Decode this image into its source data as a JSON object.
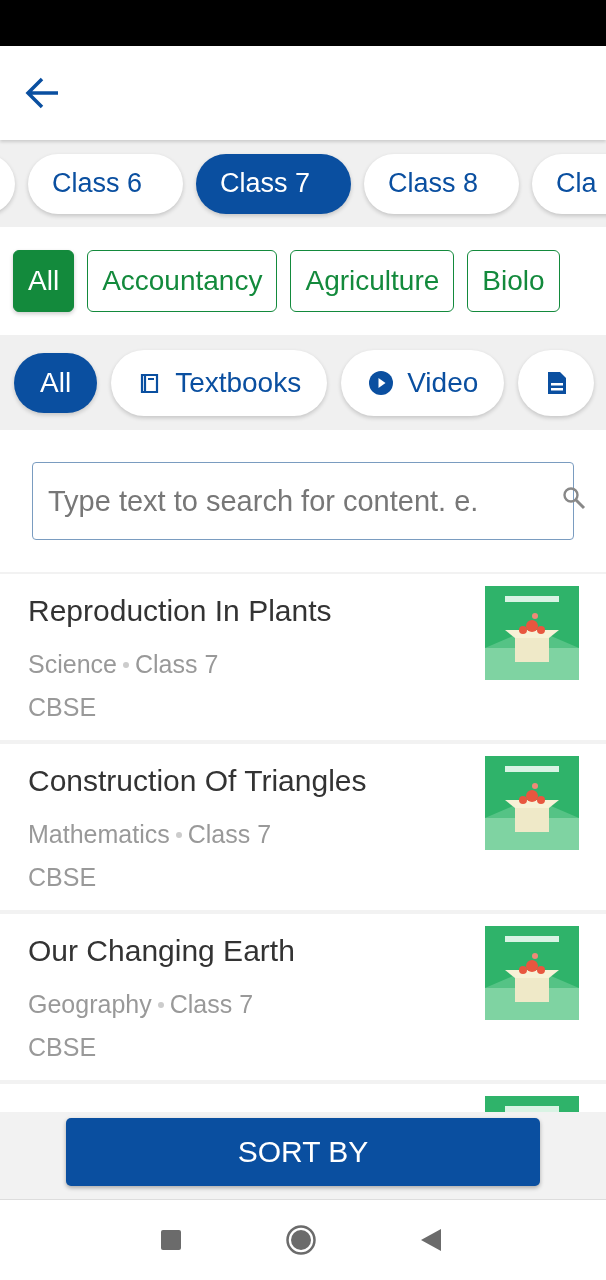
{
  "classes": [
    {
      "label": "Class 6",
      "selected": false
    },
    {
      "label": "Class 7",
      "selected": true
    },
    {
      "label": "Class 8",
      "selected": false
    },
    {
      "label": "Cla",
      "selected": false
    }
  ],
  "subjects": [
    {
      "label": "All",
      "selected": true
    },
    {
      "label": "Accountancy",
      "selected": false
    },
    {
      "label": "Agriculture",
      "selected": false
    },
    {
      "label": "Biolo",
      "selected": false
    }
  ],
  "content_types": [
    {
      "kind": "all",
      "label": "All",
      "selected": true
    },
    {
      "kind": "textbook",
      "label": "Textbooks",
      "selected": false
    },
    {
      "kind": "video",
      "label": "Video",
      "selected": false
    },
    {
      "kind": "document",
      "selected": false
    }
  ],
  "search": {
    "placeholder": "Type text to search for content. e."
  },
  "results": [
    {
      "title": "Reproduction In Plants",
      "subject": "Science",
      "class": "Class 7",
      "board": "CBSE",
      "thumbnail": {
        "kind": "picture"
      }
    },
    {
      "title": "Construction Of Triangles",
      "subject": "Mathematics",
      "class": "Class 7",
      "board": "CBSE",
      "thumbnail": {
        "kind": "picture"
      }
    },
    {
      "title": "Our Changing Earth",
      "subject": "Geography",
      "class": "Class 7",
      "board": "CBSE",
      "thumbnail": {
        "kind": "picture"
      }
    },
    {
      "thumbnail": {
        "kind": "picture"
      }
    }
  ],
  "sort_button": "SORT BY"
}
